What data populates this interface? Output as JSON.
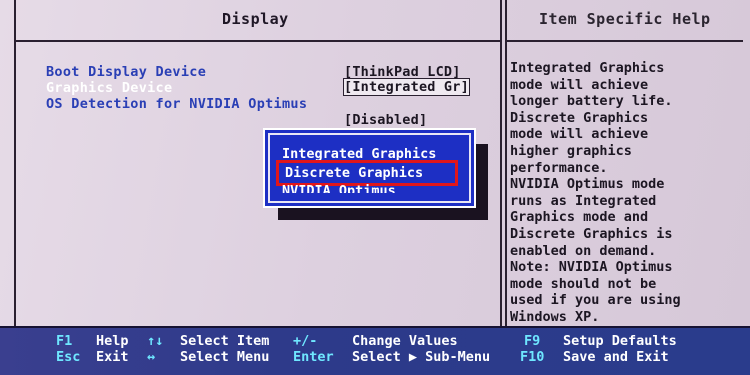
{
  "screen": {
    "left_pane_title": "Display",
    "right_pane_title": "Item Specific Help"
  },
  "menu": {
    "items": [
      {
        "label": "Boot Display Device",
        "value": "[ThinkPad LCD]"
      },
      {
        "label": "Graphics Device",
        "value": "[Integrated Gr]"
      },
      {
        "label": "OS Detection for NVIDIA Optimus",
        "value": "[Disabled]"
      }
    ],
    "selected_index": 1
  },
  "popup": {
    "options": [
      "Integrated Graphics",
      "Discrete Graphics",
      "NVIDIA Optimus"
    ],
    "highlighted_index": 1
  },
  "help": {
    "lines": [
      "Integrated Graphics",
      "mode will achieve",
      "longer battery life.",
      "Discrete Graphics",
      "mode will achieve",
      "higher graphics",
      "performance.",
      "NVIDIA Optimus mode",
      "runs as Integrated",
      "Graphics mode and",
      "Discrete Graphics is",
      "enabled on demand.",
      "Note: NVIDIA Optimus",
      "mode should not be",
      "used if you are using",
      "Windows XP."
    ]
  },
  "footer": {
    "f1_key": "F1",
    "f1_label": "Help",
    "esc_key": "Esc",
    "esc_label": "Exit",
    "updown_key": "↑↓",
    "updown_label": "Select Item",
    "leftright_key": "↔",
    "leftright_label": "Select Menu",
    "plusminus_key": "+/-",
    "plusminus_label": "Change Values",
    "enter_key": "Enter",
    "enter_label": "Select ▶ Sub-Menu",
    "f9_key": "F9",
    "f9_label": "Setup Defaults",
    "f10_key": "F10",
    "f10_label": "Save and Exit"
  },
  "colors": {
    "menu_text": "#2a3fb5",
    "popup_bg": "#1d2fc4",
    "highlight_border": "#e0161b",
    "footer_bg": "#2d3a8a",
    "footer_key": "#6fe7ff"
  }
}
